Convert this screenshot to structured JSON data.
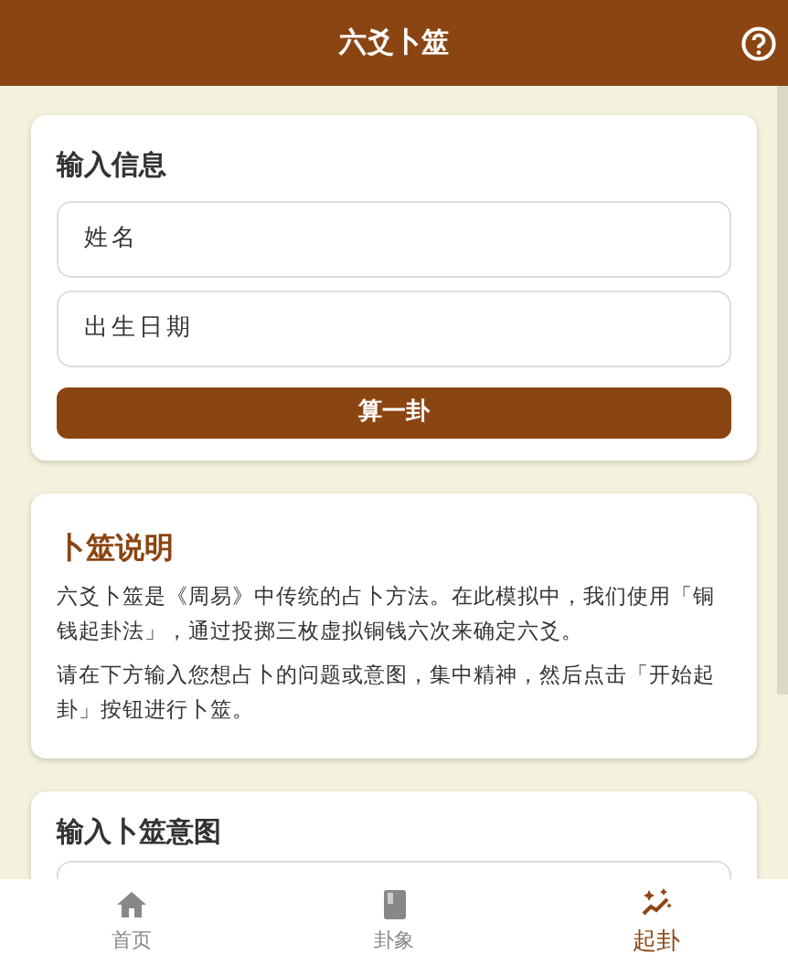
{
  "header": {
    "title": "六爻卜筮"
  },
  "info_card": {
    "title": "输入信息",
    "fields": [
      {
        "placeholder": "姓名"
      },
      {
        "placeholder": "出生日期"
      }
    ],
    "button": "算一卦"
  },
  "intro_card": {
    "title": "卜筮说明",
    "paragraphs": [
      "六爻卜筮是《周易》中传统的占卜方法。在此模拟中，我们使用「铜钱起卦法」，通过投掷三枚虚拟铜钱六次来确定六爻。",
      "请在下方输入您想占卜的问题或意图，集中精神，然后点击「开始起卦」按钮进行卜筮。"
    ]
  },
  "intent_card": {
    "title": "输入卜筮意图"
  },
  "bottom_nav": [
    {
      "label": "首页",
      "kind": "home",
      "selected": false
    },
    {
      "label": "卦象",
      "kind": "book",
      "selected": false
    },
    {
      "label": "起卦",
      "kind": "sparkle",
      "selected": true
    }
  ]
}
